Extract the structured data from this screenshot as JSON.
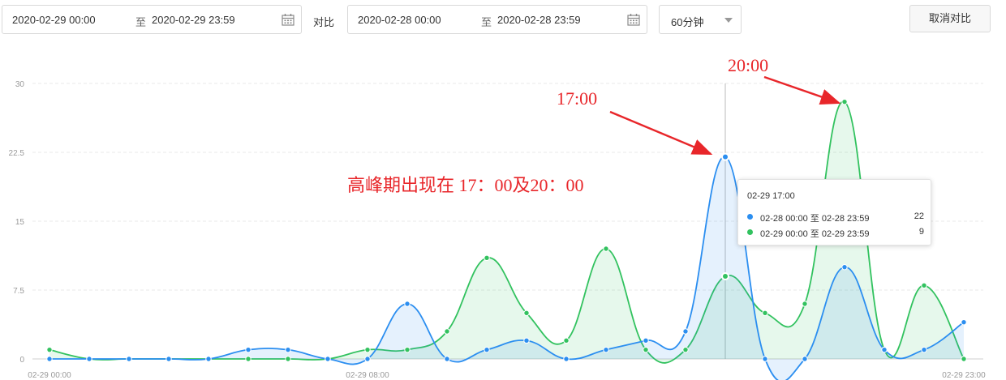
{
  "filters": {
    "range1": {
      "start": "2020-02-29 00:00",
      "sep": "至",
      "end": "2020-02-29 23:59"
    },
    "compare_label": "对比",
    "range2": {
      "start": "2020-02-28 00:00",
      "sep": "至",
      "end": "2020-02-28 23:59"
    },
    "interval": "60分钟",
    "cancel_compare": "取消对比"
  },
  "colors": {
    "blue": "#2b8ef0",
    "green": "#32c25f",
    "annotation": "#e8262a"
  },
  "chart_data": {
    "type": "area",
    "x": [
      "00:00",
      "01:00",
      "02:00",
      "03:00",
      "04:00",
      "05:00",
      "06:00",
      "07:00",
      "08:00",
      "09:00",
      "10:00",
      "11:00",
      "12:00",
      "13:00",
      "14:00",
      "15:00",
      "16:00",
      "17:00",
      "18:00",
      "19:00",
      "20:00",
      "21:00",
      "22:00",
      "23:00"
    ],
    "x_tick_labels": [
      "02-29 00:00",
      "02-29 08:00",
      "02-29 23:00"
    ],
    "x_tick_indices": [
      0,
      8,
      23
    ],
    "ylim": [
      0,
      30
    ],
    "y_ticks": [
      "0",
      "7.5",
      "15",
      "22.5",
      "30"
    ],
    "grid": true,
    "series": [
      {
        "name": "02-28 00:00 至 02-28 23:59",
        "color": "blue",
        "values": [
          0,
          0,
          0,
          0,
          0,
          1,
          1,
          0,
          0,
          6,
          0,
          1,
          2,
          0,
          1,
          2,
          3,
          22,
          0,
          0,
          10,
          1,
          1,
          4
        ]
      },
      {
        "name": "02-29 00:00 至 02-29 23:59",
        "color": "green",
        "values": [
          1,
          0,
          0,
          0,
          0,
          0,
          0,
          0,
          1,
          1,
          3,
          11,
          5,
          2,
          12,
          1,
          1,
          9,
          5,
          6,
          28,
          1,
          8,
          0
        ]
      }
    ],
    "tooltip": {
      "title": "02-29 17:00",
      "index": 17
    },
    "annotations": {
      "peak1": "17:00",
      "peak2": "20:00",
      "note": "高峰期出现在 17：00及20：00"
    }
  }
}
